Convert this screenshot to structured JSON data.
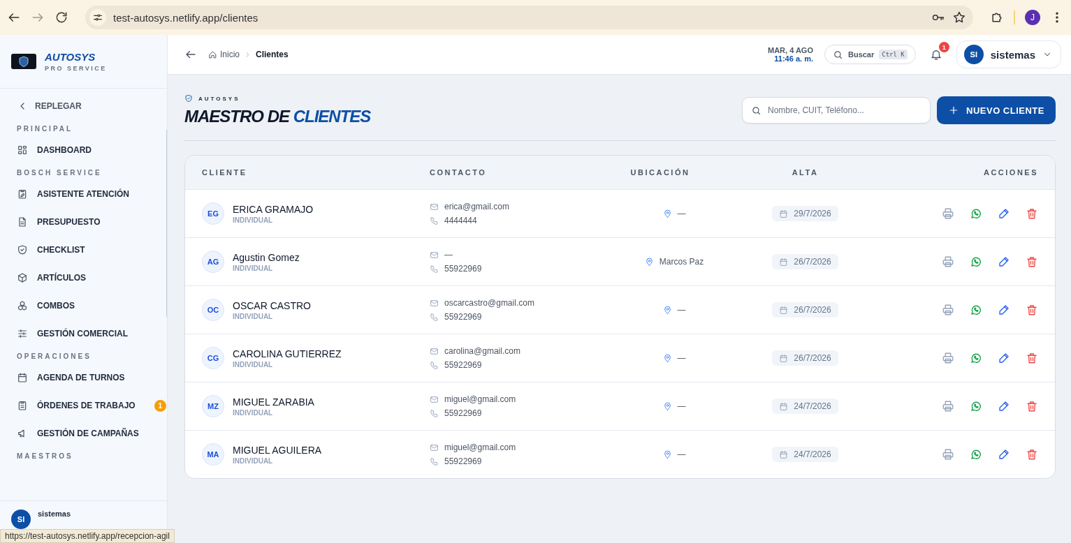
{
  "browser": {
    "url": "test-autosys.netlify.app/clientes",
    "profile_initial": "J",
    "forward_disabled": true
  },
  "sidebar": {
    "brand": "AUTOSYS",
    "tagline": "PRO SERVICE",
    "collapse_label": "REPLEGAR",
    "sections": [
      {
        "label": "PRINCIPAL",
        "items": [
          {
            "label": "DASHBOARD"
          }
        ]
      },
      {
        "label": "BOSCH SERVICE",
        "items": [
          {
            "label": "ASISTENTE ATENCIÓN"
          },
          {
            "label": "PRESUPUESTO"
          },
          {
            "label": "CHECKLIST"
          },
          {
            "label": "ARTÍCULOS"
          },
          {
            "label": "COMBOS"
          },
          {
            "label": "GESTIÓN COMERCIAL"
          }
        ]
      },
      {
        "label": "OPERACIONES",
        "items": [
          {
            "label": "AGENDA DE TURNOS"
          },
          {
            "label": "ÓRDENES DE TRABAJO",
            "badge": "1"
          },
          {
            "label": "GESTIÓN DE CAMPAÑAS"
          }
        ]
      },
      {
        "label": "MAESTROS"
      }
    ],
    "user": {
      "initials": "SI",
      "name": "sistemas"
    }
  },
  "header": {
    "breadcrumb": [
      "Inicio",
      "Clientes"
    ],
    "date": "MAR, 4 AGO",
    "time": "11:46 a. m.",
    "search_label": "Buscar",
    "search_shortcut": "Ctrl K",
    "notifications": "1",
    "user_initials": "SI",
    "user_name": "sistemas"
  },
  "page": {
    "eyebrow": "AUTOSYS",
    "title": "MAESTRO DE **CLIENTES**",
    "search_placeholder": "Nombre, CUIT, Teléfono...",
    "new_button": "NUEVO CLIENTE"
  },
  "table": {
    "columns": [
      "CLIENTE",
      "CONTACTO",
      "UBICACIÓN",
      "ALTA",
      "ACCIONES"
    ],
    "rows": [
      {
        "initials": "EG",
        "name": "ERICA GRAMAJO",
        "type": "INDIVIDUAL",
        "email": "erica@gmail.com",
        "phone": "4444444",
        "location": "—",
        "date": "29/7/2026"
      },
      {
        "initials": "AG",
        "name": "Agustin Gomez",
        "type": "INDIVIDUAL",
        "email": "—",
        "phone": "55922969",
        "location": "Marcos Paz",
        "date": "26/7/2026"
      },
      {
        "initials": "OC",
        "name": "OSCAR CASTRO",
        "type": "INDIVIDUAL",
        "email": "oscarcastro@gmail.com",
        "phone": "55922969",
        "location": "—",
        "date": "26/7/2026"
      },
      {
        "initials": "CG",
        "name": "CAROLINA GUTIERREZ",
        "type": "INDIVIDUAL",
        "email": "carolina@gmail.com",
        "phone": "55922969",
        "location": "—",
        "date": "26/7/2026"
      },
      {
        "initials": "MZ",
        "name": "MIGUEL ZARABIA",
        "type": "INDIVIDUAL",
        "email": "miguel@gmail.com",
        "phone": "55922969",
        "location": "—",
        "date": "24/7/2026"
      },
      {
        "initials": "MA",
        "name": "MIGUEL AGUILERA",
        "type": "INDIVIDUAL",
        "email": "miguel@gmail.com",
        "phone": "55922969",
        "location": "—",
        "date": "24/7/2026"
      }
    ]
  },
  "status_bar": {
    "link": "https://test-autosys.netlify.app/recepcion-agil"
  }
}
